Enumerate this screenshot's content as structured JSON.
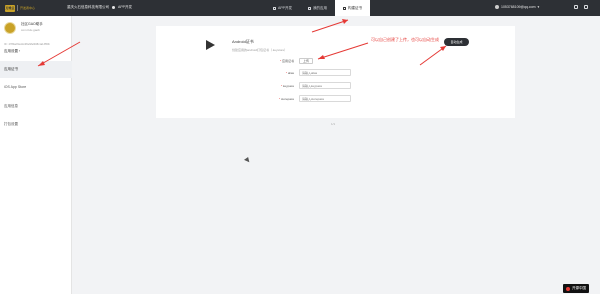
{
  "header": {
    "logo_mark": "万维云",
    "logo_sub": "开发者中心",
    "company": "重庆火石信息科技有限公司",
    "dev_label": "APP开发",
    "tabs": [
      {
        "label": "APP开发",
        "active": false
      },
      {
        "label": "我的应用",
        "active": false
      },
      {
        "label": "构建证书",
        "active": true
      }
    ],
    "account_email": "1053768109@qq.com"
  },
  "sidebar": {
    "app_name": "社区GAO助手",
    "app_package": "com.fulu.gaob",
    "app_id": "ID : 2780a2f1a11c4f0eb8e9fd8c1a13f50b",
    "section_title": "应用设置",
    "items": [
      {
        "label": "应用证书",
        "active": true
      },
      {
        "label": "iOS App Store",
        "active": false
      },
      {
        "label": "应用信息",
        "active": false
      },
      {
        "label": "打包设置",
        "active": false
      }
    ]
  },
  "main": {
    "cert_title": "Android证书",
    "cert_desc": "创建应用的android打包证书（.keystore）",
    "annotation": "可以自己创建了上传，也可以自动生成",
    "generate_button": "自动生成",
    "form": {
      "cert_file_label": "应用证书",
      "upload_label": "上传",
      "fields": [
        {
          "label": "alias",
          "placeholder": "请输入alias"
        },
        {
          "label": "keypass",
          "placeholder": "请输入keypass"
        },
        {
          "label": "storepass",
          "placeholder": "请输入storepass"
        }
      ]
    },
    "pager": "1/1"
  },
  "watermark": "开源中国"
}
